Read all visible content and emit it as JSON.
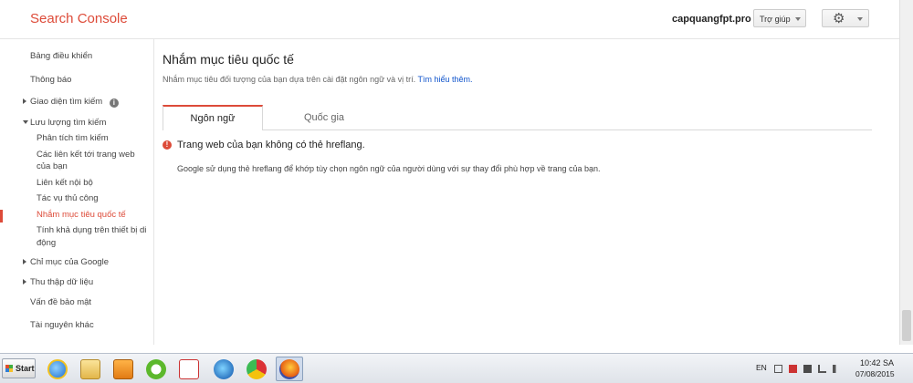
{
  "header": {
    "app_title": "Search Console",
    "site": "capquangfpt.pro",
    "help_label": "Trợ giúp"
  },
  "sidebar": {
    "items": [
      {
        "label": "Bảng điều khiển"
      },
      {
        "label": "Thông báo"
      },
      {
        "label": "Giao diện tìm kiếm"
      },
      {
        "label": "Lưu lượng tìm kiếm"
      },
      {
        "label": "Phân tích tìm kiếm"
      },
      {
        "label": "Các liên kết tới trang web"
      },
      {
        "label": "của bạn"
      },
      {
        "label": "Liên kết nội bộ"
      },
      {
        "label": "Tác vụ thủ công"
      },
      {
        "label": "Nhắm mục tiêu quốc tế"
      },
      {
        "label": "Tính khả dụng trên thiết bị di"
      },
      {
        "label": "động"
      },
      {
        "label": "Chỉ mục của Google"
      },
      {
        "label": "Thu thập dữ liệu"
      },
      {
        "label": "Vấn đề bảo mật"
      },
      {
        "label": "Tài nguyên khác"
      }
    ]
  },
  "main": {
    "title": "Nhắm mục tiêu quốc tế",
    "description": "Nhắm mục tiêu đối tượng của bạn dựa trên cài đặt ngôn ngữ và vị trí.",
    "learn_more": "Tìm hiểu thêm.",
    "tabs": [
      {
        "label": "Ngôn ngữ",
        "active": true
      },
      {
        "label": "Quốc gia",
        "active": false
      }
    ],
    "warning": "Trang web của bạn không có thẻ hreflang.",
    "info": "Google sử dụng thẻ hreflang để khớp tùy chọn ngôn ngữ của người dùng với sự thay đổi phù hợp về trang của bạn."
  },
  "taskbar": {
    "start_label": "Start",
    "language": "EN",
    "time": "10:42 SA",
    "date": "07/08/2015"
  },
  "colors": {
    "brand": "#dd4b39",
    "link": "#1155cc"
  }
}
